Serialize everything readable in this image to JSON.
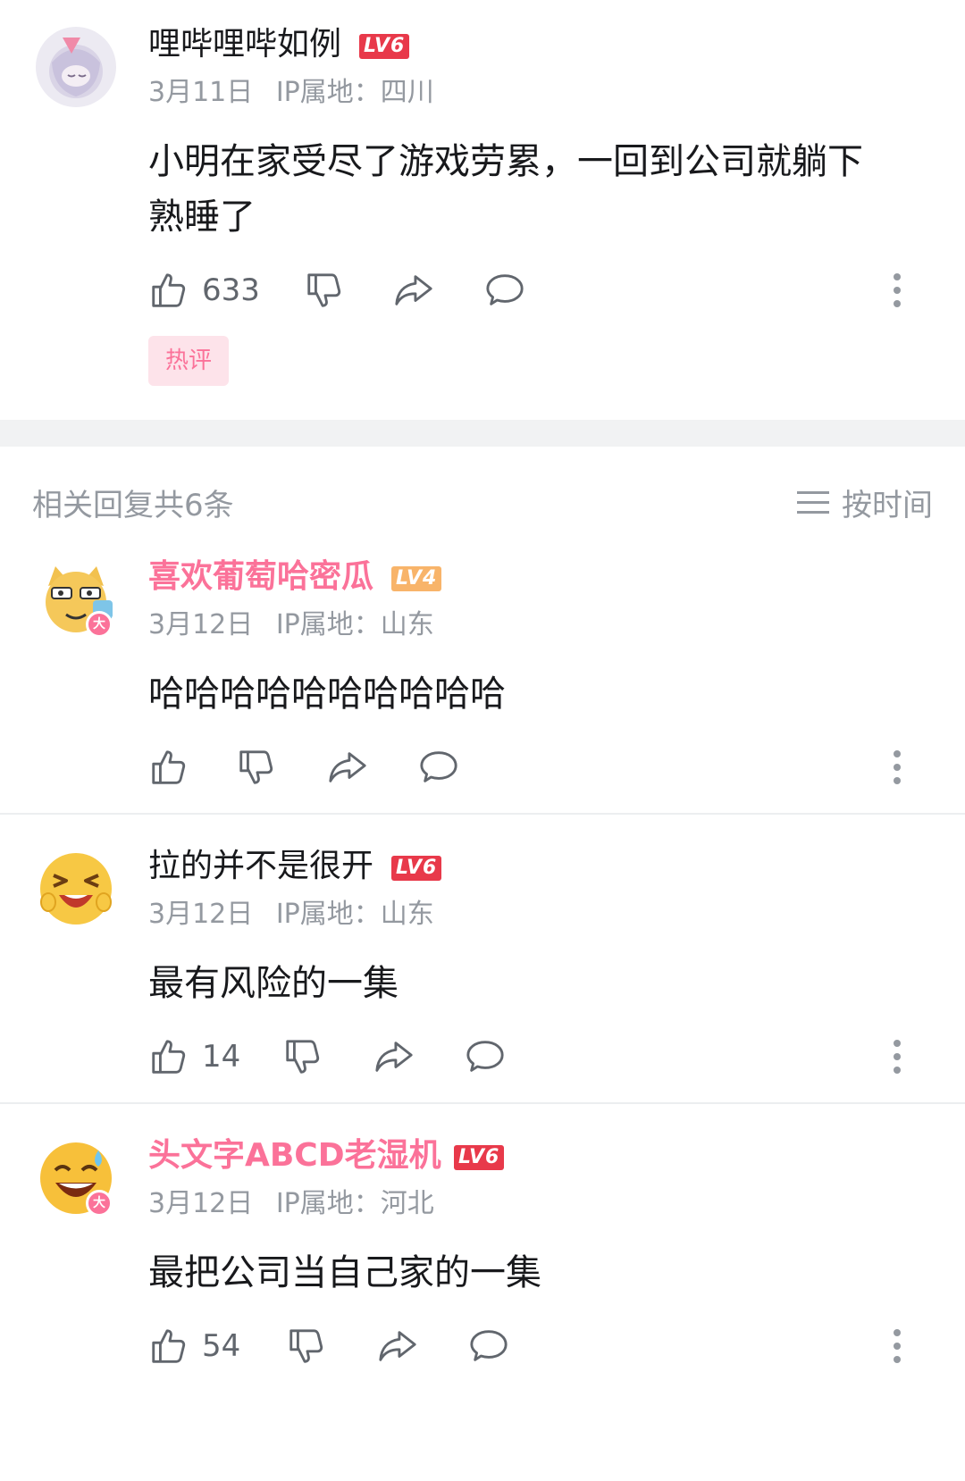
{
  "root": {
    "username": "哩哔哩哔如例",
    "level": "LV6",
    "date": "3月11日",
    "ip": "IP属地：四川",
    "content": "小明在家受尽了游戏劳累，一回到公司就躺下熟睡了",
    "likes": "633",
    "tag": "热评"
  },
  "replies_header": {
    "title": "相关回复共6条",
    "sort_label": "按时间"
  },
  "replies": [
    {
      "username": "喜欢葡萄哈密瓜",
      "level": "LV4",
      "date": "3月12日",
      "ip": "IP属地：山东",
      "content": "哈哈哈哈哈哈哈哈哈哈",
      "likes": "",
      "badge": "大"
    },
    {
      "username": "拉的并不是很开",
      "level": "LV6",
      "date": "3月12日",
      "ip": "IP属地：山东",
      "content": "最有风险的一集",
      "likes": "14",
      "badge": ""
    },
    {
      "username": "头文字ABCD老湿机",
      "level": "LV6",
      "date": "3月12日",
      "ip": "IP属地：河北",
      "content": "最把公司当自己家的一集",
      "likes": "54",
      "badge": "大"
    }
  ],
  "icons": {
    "like": "thumb-up-icon",
    "dislike": "thumb-down-icon",
    "share": "share-arrow-icon",
    "reply": "chat-bubble-icon",
    "more": "more-vertical-icon",
    "sort": "menu-lines-icon"
  },
  "colors": {
    "vip_name": "#fb7299",
    "meta": "#9499a0",
    "lv6": "#e8394a",
    "lv4": "#f8b46a"
  }
}
